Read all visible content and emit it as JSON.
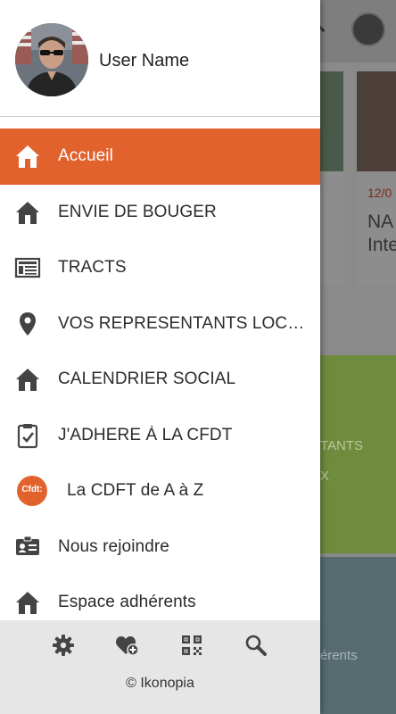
{
  "background": {
    "card_date": "12/0",
    "card_title_line1": "NA",
    "card_title_line2": "Inte",
    "green_text": "TANTS",
    "green_sub": "X",
    "teal_text": "érents"
  },
  "drawer": {
    "user_name": "User Name",
    "menu": [
      {
        "label": "Accueil",
        "icon": "home-icon",
        "active": true
      },
      {
        "label": "ENVIE DE BOUGER",
        "icon": "home-icon"
      },
      {
        "label": "TRACTS",
        "icon": "newspaper-icon"
      },
      {
        "label": "VOS REPRESENTANTS LOCAUX",
        "icon": "location-pin-icon"
      },
      {
        "label": "CALENDRIER SOCIAL",
        "icon": "home-icon"
      },
      {
        "label": "J'ADHERE À LA CFDT",
        "icon": "clipboard-check-icon"
      },
      {
        "label": "La CDFT de A à Z",
        "icon": "cfdt-logo-icon",
        "logo_text": "Cfdt:"
      },
      {
        "label": "Nous rejoindre",
        "icon": "id-card-icon"
      },
      {
        "label": "Espace adhérents",
        "icon": "home-icon"
      }
    ],
    "footer": {
      "icons": [
        "gear-icon",
        "heart-plus-icon",
        "qr-code-icon",
        "search-icon"
      ],
      "copyright": "© Ikonopia"
    }
  },
  "colors": {
    "accent": "#e1622d",
    "icon": "#444444",
    "footer_bg": "#e6e6e6"
  }
}
